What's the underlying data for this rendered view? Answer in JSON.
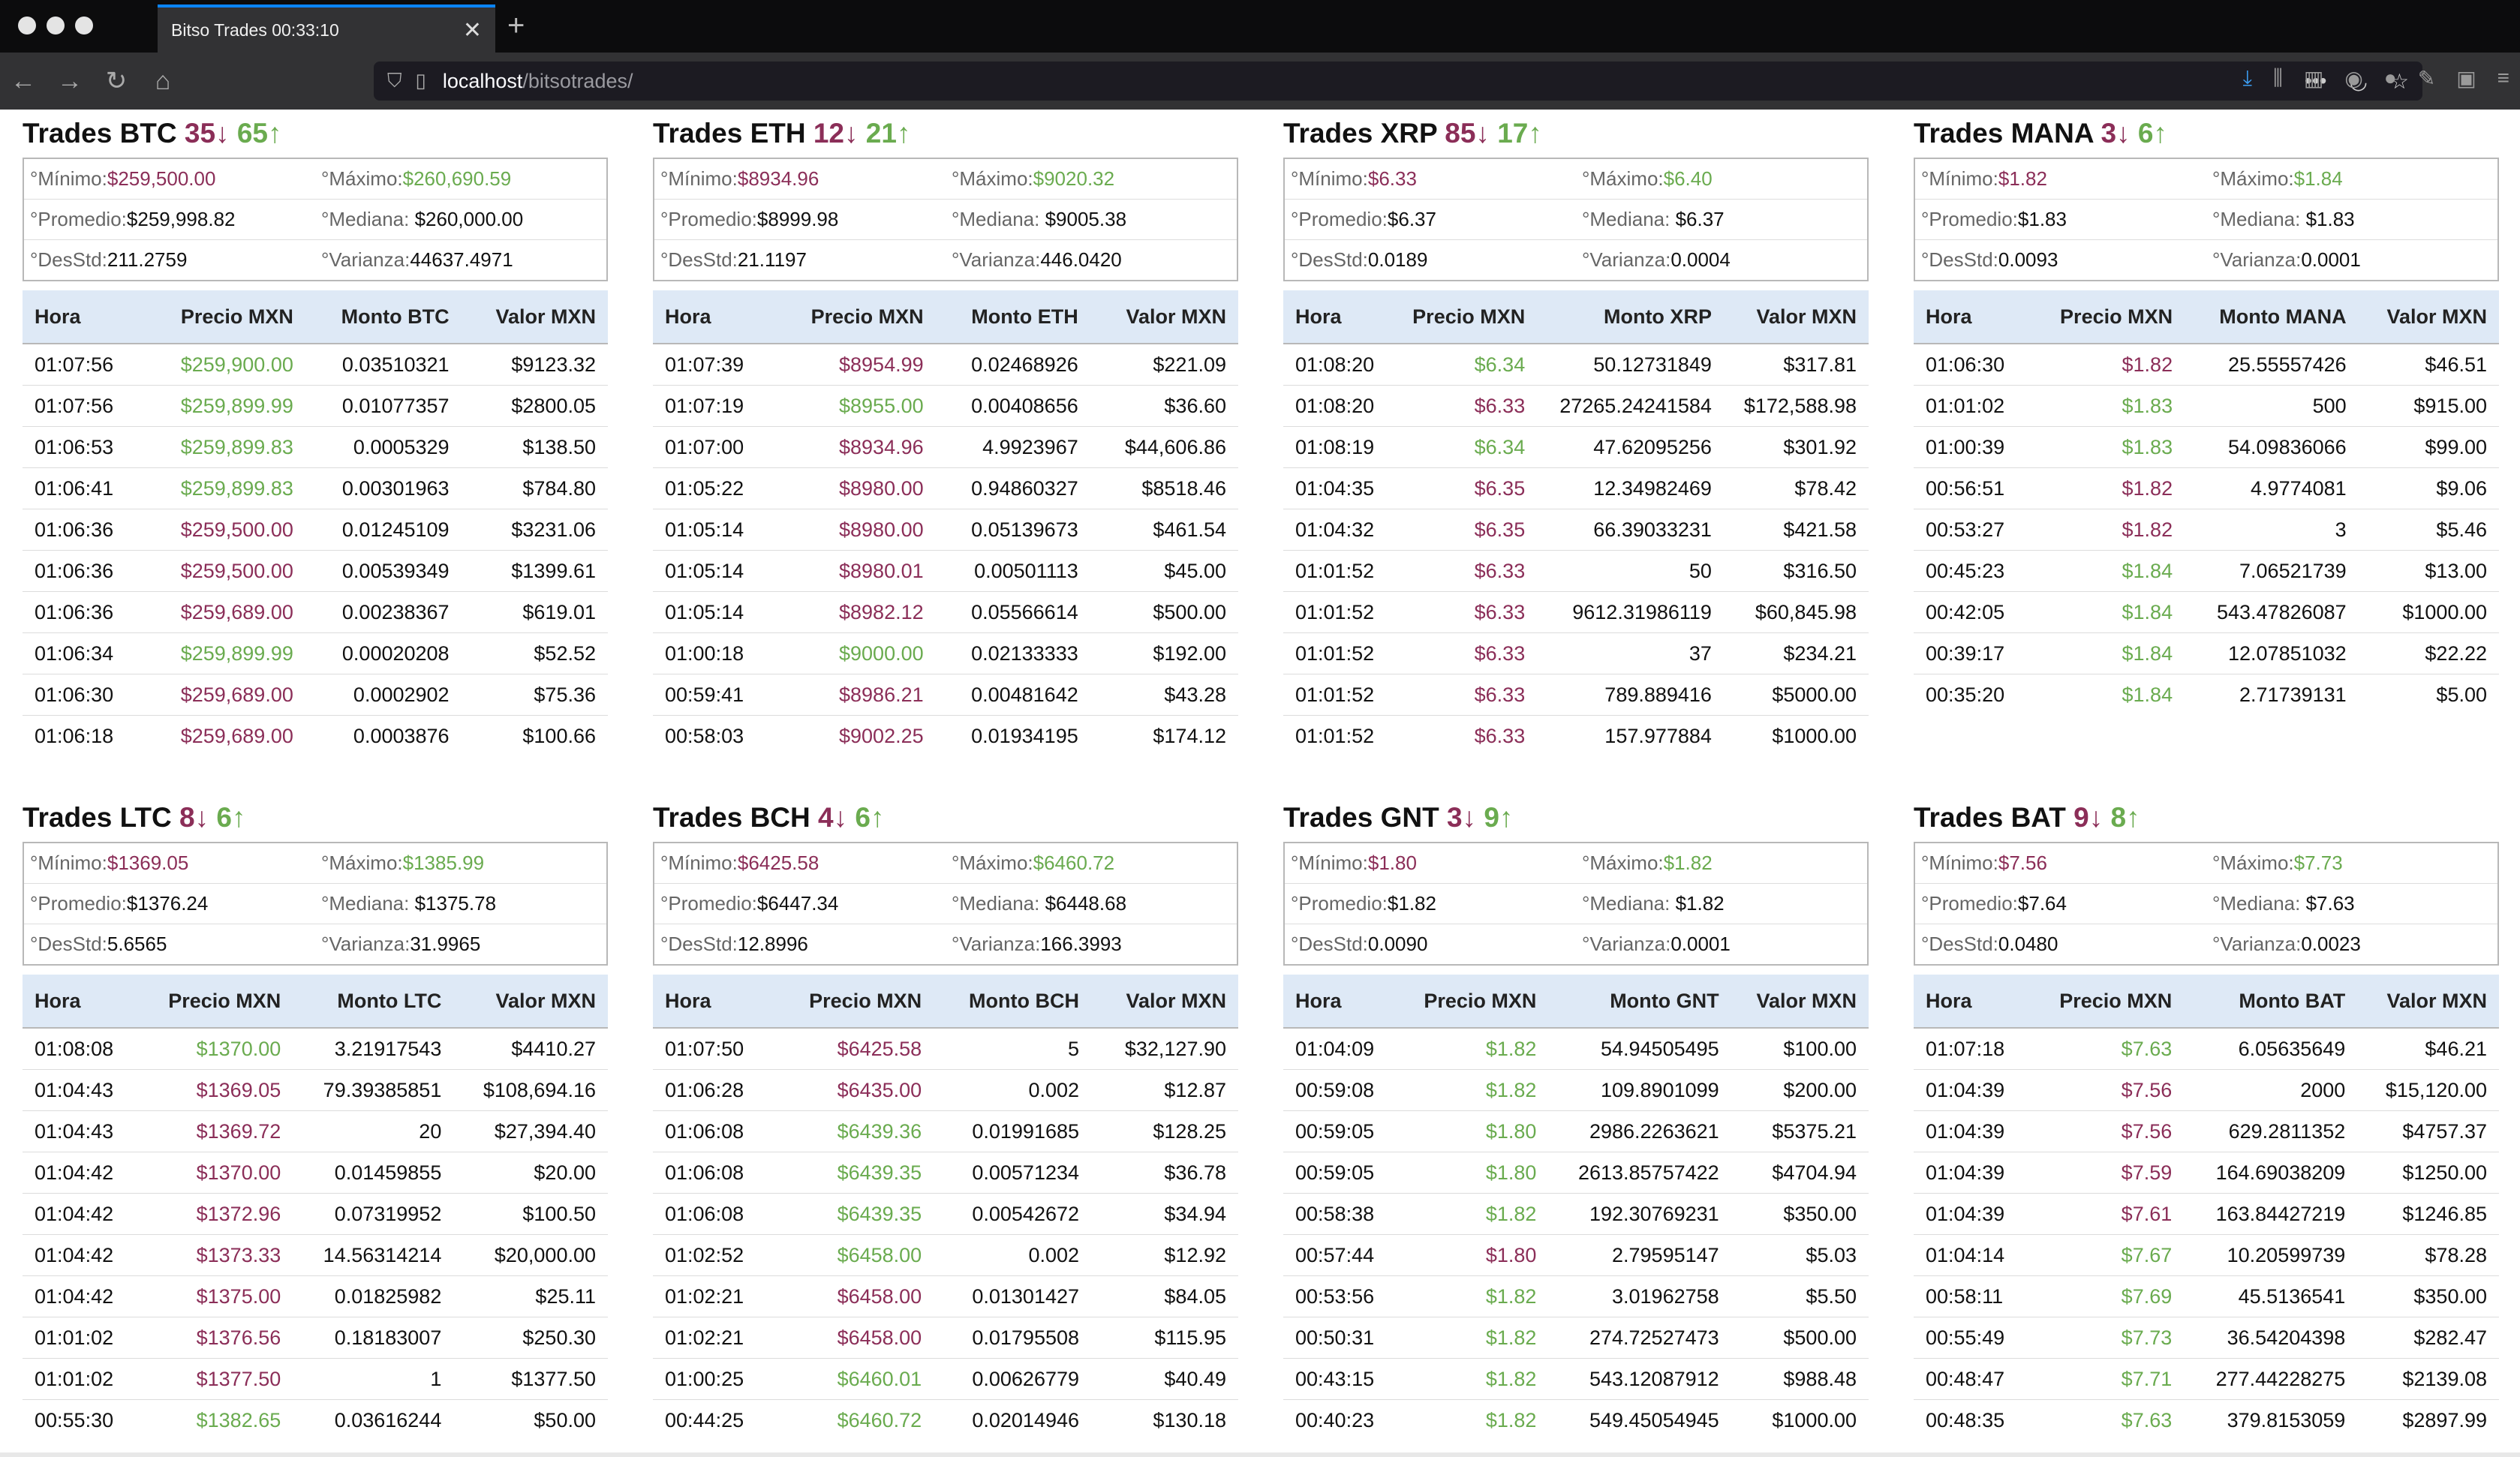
{
  "browser": {
    "tab_title": "Bitso Trades 00:33:10",
    "url_host": "localhost",
    "url_path": "/bitsotrades/"
  },
  "colors": {
    "down": "#8b2e58",
    "up": "#6aab4f",
    "header_bg": "#dee9f6"
  },
  "stat_labels": {
    "min": "°Mínimo:",
    "max": "°Máximo:",
    "avg": "°Promedio:",
    "median": "°Mediana:",
    "std": "°DesStd:",
    "var": "°Varianza:"
  },
  "panels": [
    {
      "title": "Trades BTC",
      "down": "35↓",
      "up": "65↑",
      "stats": {
        "min": "$259,500.00",
        "max": "$260,690.59",
        "avg": "$259,998.82",
        "median": " $260,000.00",
        "std": "211.2759",
        "var": "44637.4971"
      },
      "headers": [
        "Hora",
        "Precio MXN",
        "Monto BTC",
        "Valor MXN"
      ],
      "rows": [
        [
          "01:07:56",
          "$259,900.00",
          "0.03510321",
          "$9123.32",
          "g"
        ],
        [
          "01:07:56",
          "$259,899.99",
          "0.01077357",
          "$2800.05",
          "g"
        ],
        [
          "01:06:53",
          "$259,899.83",
          "0.0005329",
          "$138.50",
          "g"
        ],
        [
          "01:06:41",
          "$259,899.83",
          "0.00301963",
          "$784.80",
          "g"
        ],
        [
          "01:06:36",
          "$259,500.00",
          "0.01245109",
          "$3231.06",
          "r"
        ],
        [
          "01:06:36",
          "$259,500.00",
          "0.00539349",
          "$1399.61",
          "r"
        ],
        [
          "01:06:36",
          "$259,689.00",
          "0.00238367",
          "$619.01",
          "r"
        ],
        [
          "01:06:34",
          "$259,899.99",
          "0.00020208",
          "$52.52",
          "g"
        ],
        [
          "01:06:30",
          "$259,689.00",
          "0.0002902",
          "$75.36",
          "r"
        ],
        [
          "01:06:18",
          "$259,689.00",
          "0.0003876",
          "$100.66",
          "r"
        ]
      ]
    },
    {
      "title": "Trades ETH",
      "down": "12↓",
      "up": "21↑",
      "stats": {
        "min": "$8934.96",
        "max": "$9020.32",
        "avg": "$8999.98",
        "median": " $9005.38",
        "std": "21.1197",
        "var": "446.0420"
      },
      "headers": [
        "Hora",
        "Precio MXN",
        "Monto ETH",
        "Valor MXN"
      ],
      "rows": [
        [
          "01:07:39",
          "$8954.99",
          "0.02468926",
          "$221.09",
          "r"
        ],
        [
          "01:07:19",
          "$8955.00",
          "0.00408656",
          "$36.60",
          "g"
        ],
        [
          "01:07:00",
          "$8934.96",
          "4.9923967",
          "$44,606.86",
          "r"
        ],
        [
          "01:05:22",
          "$8980.00",
          "0.94860327",
          "$8518.46",
          "r"
        ],
        [
          "01:05:14",
          "$8980.00",
          "0.05139673",
          "$461.54",
          "r"
        ],
        [
          "01:05:14",
          "$8980.01",
          "0.00501113",
          "$45.00",
          "r"
        ],
        [
          "01:05:14",
          "$8982.12",
          "0.05566614",
          "$500.00",
          "r"
        ],
        [
          "01:00:18",
          "$9000.00",
          "0.02133333",
          "$192.00",
          "g"
        ],
        [
          "00:59:41",
          "$8986.21",
          "0.00481642",
          "$43.28",
          "r"
        ],
        [
          "00:58:03",
          "$9002.25",
          "0.01934195",
          "$174.12",
          "r"
        ]
      ]
    },
    {
      "title": "Trades XRP",
      "down": "85↓",
      "up": "17↑",
      "stats": {
        "min": "$6.33",
        "max": "$6.40",
        "avg": "$6.37",
        "median": " $6.37",
        "std": "0.0189",
        "var": "0.0004"
      },
      "headers": [
        "Hora",
        "Precio MXN",
        "Monto XRP",
        "Valor MXN"
      ],
      "rows": [
        [
          "01:08:20",
          "$6.34",
          "50.12731849",
          "$317.81",
          "g"
        ],
        [
          "01:08:20",
          "$6.33",
          "27265.24241584",
          "$172,588.98",
          "r"
        ],
        [
          "01:08:19",
          "$6.34",
          "47.62095256",
          "$301.92",
          "g"
        ],
        [
          "01:04:35",
          "$6.35",
          "12.34982469",
          "$78.42",
          "r"
        ],
        [
          "01:04:32",
          "$6.35",
          "66.39033231",
          "$421.58",
          "r"
        ],
        [
          "01:01:52",
          "$6.33",
          "50",
          "$316.50",
          "r"
        ],
        [
          "01:01:52",
          "$6.33",
          "9612.31986119",
          "$60,845.98",
          "r"
        ],
        [
          "01:01:52",
          "$6.33",
          "37",
          "$234.21",
          "r"
        ],
        [
          "01:01:52",
          "$6.33",
          "789.889416",
          "$5000.00",
          "r"
        ],
        [
          "01:01:52",
          "$6.33",
          "157.977884",
          "$1000.00",
          "r"
        ]
      ]
    },
    {
      "title": "Trades MANA",
      "down": "3↓",
      "up": "6↑",
      "stats": {
        "min": "$1.82",
        "max": "$1.84",
        "avg": "$1.83",
        "median": " $1.83",
        "std": "0.0093",
        "var": "0.0001"
      },
      "headers": [
        "Hora",
        "Precio MXN",
        "Monto MANA",
        "Valor MXN"
      ],
      "rows": [
        [
          "01:06:30",
          "$1.82",
          "25.55557426",
          "$46.51",
          "r"
        ],
        [
          "01:01:02",
          "$1.83",
          "500",
          "$915.00",
          "g"
        ],
        [
          "01:00:39",
          "$1.83",
          "54.09836066",
          "$99.00",
          "g"
        ],
        [
          "00:56:51",
          "$1.82",
          "4.9774081",
          "$9.06",
          "r"
        ],
        [
          "00:53:27",
          "$1.82",
          "3",
          "$5.46",
          "r"
        ],
        [
          "00:45:23",
          "$1.84",
          "7.06521739",
          "$13.00",
          "g"
        ],
        [
          "00:42:05",
          "$1.84",
          "543.47826087",
          "$1000.00",
          "g"
        ],
        [
          "00:39:17",
          "$1.84",
          "12.07851032",
          "$22.22",
          "g"
        ],
        [
          "00:35:20",
          "$1.84",
          "2.71739131",
          "$5.00",
          "g"
        ]
      ]
    },
    {
      "title": "Trades LTC",
      "down": "8↓",
      "up": "6↑",
      "stats": {
        "min": "$1369.05",
        "max": "$1385.99",
        "avg": "$1376.24",
        "median": " $1375.78",
        "std": "5.6565",
        "var": "31.9965"
      },
      "headers": [
        "Hora",
        "Precio MXN",
        "Monto LTC",
        "Valor MXN"
      ],
      "rows": [
        [
          "01:08:08",
          "$1370.00",
          "3.21917543",
          "$4410.27",
          "g"
        ],
        [
          "01:04:43",
          "$1369.05",
          "79.39385851",
          "$108,694.16",
          "r"
        ],
        [
          "01:04:43",
          "$1369.72",
          "20",
          "$27,394.40",
          "r"
        ],
        [
          "01:04:42",
          "$1370.00",
          "0.01459855",
          "$20.00",
          "r"
        ],
        [
          "01:04:42",
          "$1372.96",
          "0.07319952",
          "$100.50",
          "r"
        ],
        [
          "01:04:42",
          "$1373.33",
          "14.56314214",
          "$20,000.00",
          "r"
        ],
        [
          "01:04:42",
          "$1375.00",
          "0.01825982",
          "$25.11",
          "r"
        ],
        [
          "01:01:02",
          "$1376.56",
          "0.18183007",
          "$250.30",
          "r"
        ],
        [
          "01:01:02",
          "$1377.50",
          "1",
          "$1377.50",
          "r"
        ],
        [
          "00:55:30",
          "$1382.65",
          "0.03616244",
          "$50.00",
          "g"
        ]
      ]
    },
    {
      "title": "Trades BCH",
      "down": "4↓",
      "up": "6↑",
      "stats": {
        "min": "$6425.58",
        "max": "$6460.72",
        "avg": "$6447.34",
        "median": " $6448.68",
        "std": "12.8996",
        "var": "166.3993"
      },
      "headers": [
        "Hora",
        "Precio MXN",
        "Monto BCH",
        "Valor MXN"
      ],
      "rows": [
        [
          "01:07:50",
          "$6425.58",
          "5",
          "$32,127.90",
          "r"
        ],
        [
          "01:06:28",
          "$6435.00",
          "0.002",
          "$12.87",
          "r"
        ],
        [
          "01:06:08",
          "$6439.36",
          "0.01991685",
          "$128.25",
          "g"
        ],
        [
          "01:06:08",
          "$6439.35",
          "0.00571234",
          "$36.78",
          "g"
        ],
        [
          "01:06:08",
          "$6439.35",
          "0.00542672",
          "$34.94",
          "g"
        ],
        [
          "01:02:52",
          "$6458.00",
          "0.002",
          "$12.92",
          "g"
        ],
        [
          "01:02:21",
          "$6458.00",
          "0.01301427",
          "$84.05",
          "r"
        ],
        [
          "01:02:21",
          "$6458.00",
          "0.01795508",
          "$115.95",
          "r"
        ],
        [
          "01:00:25",
          "$6460.01",
          "0.00626779",
          "$40.49",
          "g"
        ],
        [
          "00:44:25",
          "$6460.72",
          "0.02014946",
          "$130.18",
          "g"
        ]
      ]
    },
    {
      "title": "Trades GNT",
      "down": "3↓",
      "up": "9↑",
      "stats": {
        "min": "$1.80",
        "max": "$1.82",
        "avg": "$1.82",
        "median": " $1.82",
        "std": "0.0090",
        "var": "0.0001"
      },
      "headers": [
        "Hora",
        "Precio MXN",
        "Monto GNT",
        "Valor MXN"
      ],
      "rows": [
        [
          "01:04:09",
          "$1.82",
          "54.94505495",
          "$100.00",
          "g"
        ],
        [
          "00:59:08",
          "$1.82",
          "109.8901099",
          "$200.00",
          "g"
        ],
        [
          "00:59:05",
          "$1.80",
          "2986.2263621",
          "$5375.21",
          "g"
        ],
        [
          "00:59:05",
          "$1.80",
          "2613.85757422",
          "$4704.94",
          "g"
        ],
        [
          "00:58:38",
          "$1.82",
          "192.30769231",
          "$350.00",
          "g"
        ],
        [
          "00:57:44",
          "$1.80",
          "2.79595147",
          "$5.03",
          "r"
        ],
        [
          "00:53:56",
          "$1.82",
          "3.01962758",
          "$5.50",
          "g"
        ],
        [
          "00:50:31",
          "$1.82",
          "274.72527473",
          "$500.00",
          "g"
        ],
        [
          "00:43:15",
          "$1.82",
          "543.12087912",
          "$988.48",
          "g"
        ],
        [
          "00:40:23",
          "$1.82",
          "549.45054945",
          "$1000.00",
          "g"
        ]
      ]
    },
    {
      "title": "Trades BAT",
      "down": "9↓",
      "up": "8↑",
      "stats": {
        "min": "$7.56",
        "max": "$7.73",
        "avg": "$7.64",
        "median": " $7.63",
        "std": "0.0480",
        "var": "0.0023"
      },
      "headers": [
        "Hora",
        "Precio MXN",
        "Monto BAT",
        "Valor MXN"
      ],
      "rows": [
        [
          "01:07:18",
          "$7.63",
          "6.05635649",
          "$46.21",
          "g"
        ],
        [
          "01:04:39",
          "$7.56",
          "2000",
          "$15,120.00",
          "r"
        ],
        [
          "01:04:39",
          "$7.56",
          "629.2811352",
          "$4757.37",
          "r"
        ],
        [
          "01:04:39",
          "$7.59",
          "164.69038209",
          "$1250.00",
          "r"
        ],
        [
          "01:04:39",
          "$7.61",
          "163.84427219",
          "$1246.85",
          "r"
        ],
        [
          "01:04:14",
          "$7.67",
          "10.20599739",
          "$78.28",
          "g"
        ],
        [
          "00:58:11",
          "$7.69",
          "45.5136541",
          "$350.00",
          "g"
        ],
        [
          "00:55:49",
          "$7.73",
          "36.54204398",
          "$282.47",
          "g"
        ],
        [
          "00:48:47",
          "$7.71",
          "277.44228275",
          "$2139.08",
          "g"
        ],
        [
          "00:48:35",
          "$7.63",
          "379.8153059",
          "$2897.99",
          "g"
        ]
      ]
    }
  ]
}
